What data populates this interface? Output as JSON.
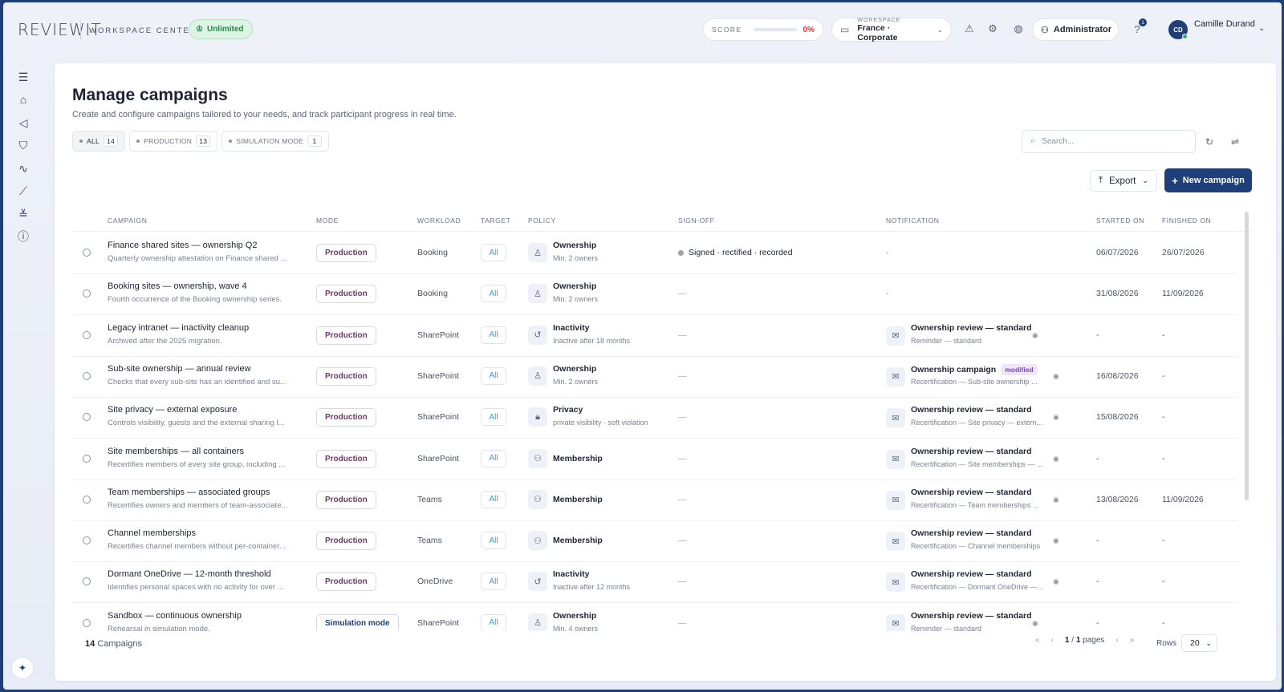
{
  "app": {
    "logo": "REVIEWIT",
    "section": "WORKSPACE CENTER",
    "plan": "Unlimited"
  },
  "header": {
    "score_label": "SCORE",
    "score_value": "0%",
    "score_fraction": 0.0,
    "workspace_small": "WORKSPACE",
    "workspace_name": "France · Corporate",
    "role": "Administrator",
    "help_badge": "1",
    "user_initials": "CD",
    "user_name": "Camille Durand"
  },
  "page": {
    "title": "Manage campaigns",
    "subtitle": "Create and configure campaigns tailored to your needs, and track participant progress in real time.",
    "filters": [
      {
        "label": "ALL",
        "count": "14"
      },
      {
        "label": "PRODUCTION",
        "count": "13"
      },
      {
        "label": "SIMULATION MODE",
        "count": "1"
      }
    ],
    "search_placeholder": "Search...",
    "export_label": "Export",
    "new_campaign_label": "New campaign"
  },
  "table": {
    "columns": [
      "CAMPAIGN",
      "MODE",
      "WORKLOAD",
      "TARGET",
      "POLICY",
      "SIGN-OFF",
      "NOTIFICATION",
      "STARTED ON",
      "FINISHED ON"
    ],
    "rows": [
      {
        "name": "Finance shared sites — ownership Q2",
        "desc": "Quarterly ownership attestation on Finance shared ...",
        "mode": "Production",
        "workload": "Booking",
        "target": "All",
        "policy": "Ownership",
        "policy_sub": "Min. 2 owners",
        "policy_icon": "user-icon",
        "signoff": "Signed · rectified · recorded",
        "notif": "-",
        "notif_sub": "",
        "badge": "",
        "started": "06/07/2026",
        "finished": "26/07/2026"
      },
      {
        "name": "Booking sites — ownership, wave 4",
        "desc": "Fourth occurrence of the Booking ownership series.",
        "mode": "Production",
        "workload": "Booking",
        "target": "All",
        "policy": "Ownership",
        "policy_sub": "Min. 2 owners",
        "policy_icon": "user-icon",
        "signoff": "—",
        "notif": "-",
        "notif_sub": "",
        "badge": "",
        "started": "31/08/2026",
        "finished": "11/09/2026"
      },
      {
        "name": "Legacy intranet — inactivity cleanup",
        "desc": "Archived after the 2025 migration.",
        "mode": "Production",
        "workload": "SharePoint",
        "target": "All",
        "policy": "Inactivity",
        "policy_sub": "Inactive after 18 months",
        "policy_icon": "history-icon",
        "signoff": "—",
        "notif": "Ownership review — standard",
        "notif_sub": "Reminder — standard",
        "badge": "",
        "started": "-",
        "finished": "-"
      },
      {
        "name": "Sub-site ownership — annual review",
        "desc": "Checks that every sub-site has an identified and su...",
        "mode": "Production",
        "workload": "SharePoint",
        "target": "All",
        "policy": "Ownership",
        "policy_sub": "Min. 2 owners",
        "policy_icon": "user-icon",
        "signoff": "—",
        "notif": "Ownership campaign",
        "notif_sub": "Recertification — Sub-site ownership ...",
        "badge": "modified",
        "started": "16/08/2026",
        "finished": "-"
      },
      {
        "name": "Site privacy — external exposure",
        "desc": "Controls visibility, guests and the external sharing l...",
        "mode": "Production",
        "workload": "SharePoint",
        "target": "All",
        "policy": "Privacy",
        "policy_sub": "private visibility · soft violation",
        "policy_icon": "lock-icon",
        "signoff": "—",
        "notif": "Ownership review — standard",
        "notif_sub": "Recertification — Site privacy — extern...",
        "badge": "",
        "started": "15/08/2026",
        "finished": "-"
      },
      {
        "name": "Site memberships — all containers",
        "desc": "Recertifies members of every site group, including ...",
        "mode": "Production",
        "workload": "SharePoint",
        "target": "All",
        "policy": "Membership",
        "policy_sub": "",
        "policy_icon": "users-icon",
        "signoff": "—",
        "notif": "Ownership review — standard",
        "notif_sub": "Recertification — Site memberships — ...",
        "badge": "",
        "started": "-",
        "finished": "-"
      },
      {
        "name": "Team memberships — associated groups",
        "desc": "Recertifies owners and members of team-associate...",
        "mode": "Production",
        "workload": "Teams",
        "target": "All",
        "policy": "Membership",
        "policy_sub": "",
        "policy_icon": "users-icon",
        "signoff": "—",
        "notif": "Ownership review — standard",
        "notif_sub": "Recertification — Team memberships ...",
        "badge": "",
        "started": "13/08/2026",
        "finished": "11/09/2026"
      },
      {
        "name": "Channel memberships",
        "desc": "Recertifies channel members without per-container...",
        "mode": "Production",
        "workload": "Teams",
        "target": "All",
        "policy": "Membership",
        "policy_sub": "",
        "policy_icon": "users-icon",
        "signoff": "—",
        "notif": "Ownership review — standard",
        "notif_sub": "Recertification — Channel memberships",
        "badge": "",
        "started": "-",
        "finished": "-"
      },
      {
        "name": "Dormant OneDrive — 12-month threshold",
        "desc": "Identifies personal spaces with no activity for over ...",
        "mode": "Production",
        "workload": "OneDrive",
        "target": "All",
        "policy": "Inactivity",
        "policy_sub": "Inactive after 12 months",
        "policy_icon": "history-icon",
        "signoff": "—",
        "notif": "Ownership review — standard",
        "notif_sub": "Recertification — Dormant OneDrive —...",
        "badge": "",
        "started": "-",
        "finished": "-"
      },
      {
        "name": "Sandbox — continuous ownership",
        "desc": "Rehearsal in simulation mode.",
        "mode": "Simulation mode",
        "workload": "SharePoint",
        "target": "All",
        "policy": "Ownership",
        "policy_sub": "Min. 4 owners",
        "policy_icon": "user-icon",
        "signoff": "—",
        "notif": "Ownership review — standard",
        "notif_sub": "Reminder — standard",
        "badge": "",
        "started": "-",
        "finished": "-"
      }
    ]
  },
  "footer": {
    "count": "14",
    "count_label": "Campaigns",
    "page_current": "1",
    "page_total": "1",
    "pages_label": "pages",
    "rows_label": "Rows",
    "rows_value": "20"
  }
}
